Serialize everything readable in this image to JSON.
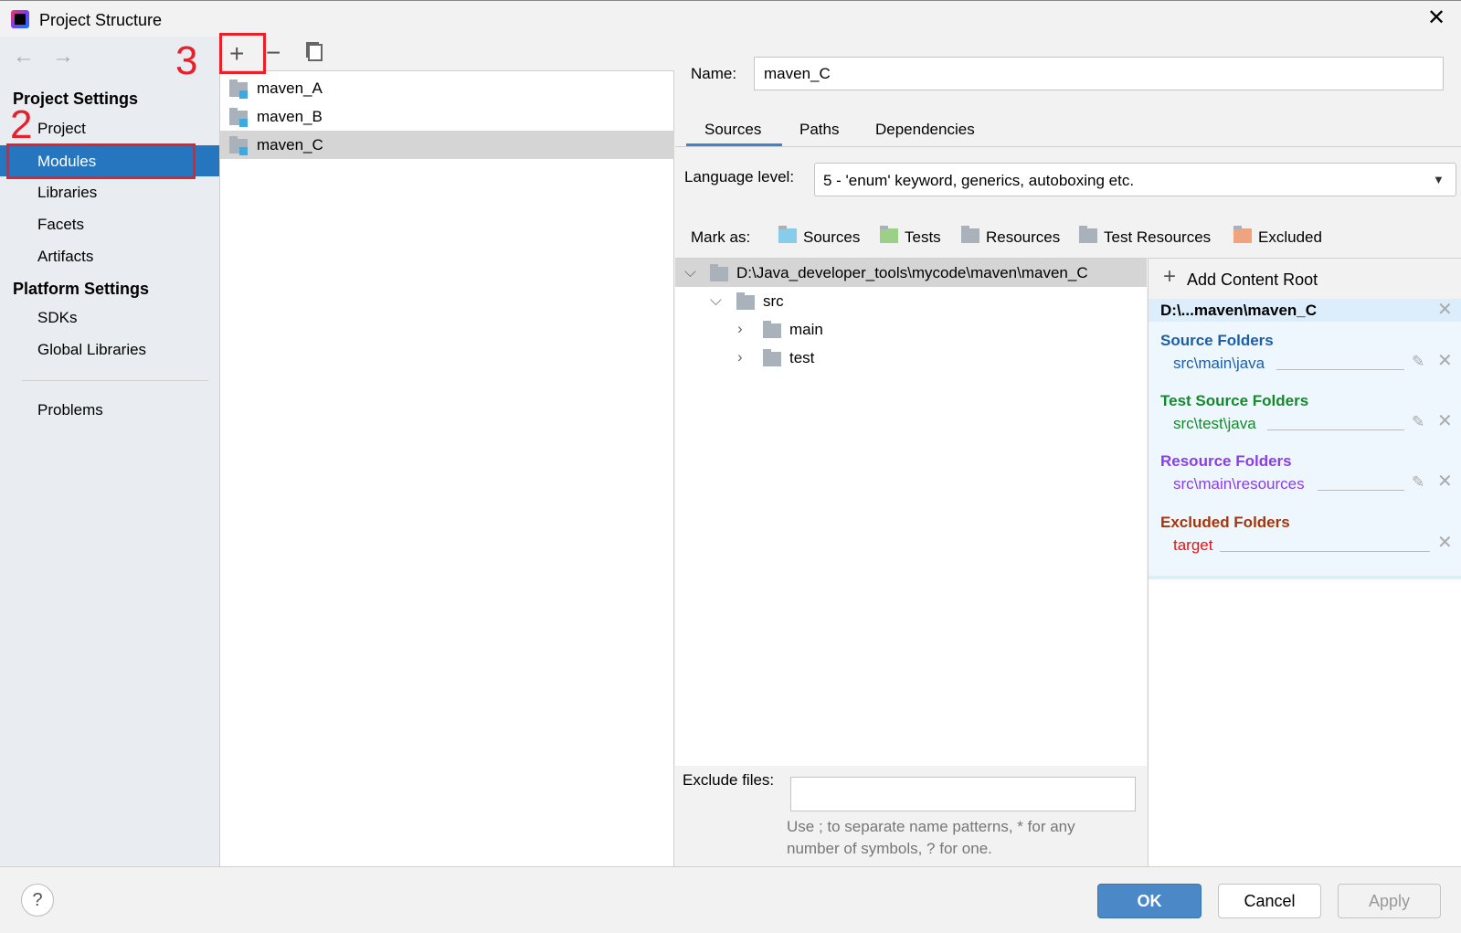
{
  "window": {
    "title": "Project Structure",
    "close_icon": "close-icon"
  },
  "sidebar": {
    "project_settings": "Project Settings",
    "project_items": [
      "Project",
      "Modules",
      "Libraries",
      "Facets",
      "Artifacts"
    ],
    "platform_settings": "Platform Settings",
    "platform_items": [
      "SDKs",
      "Global Libraries"
    ],
    "problems": "Problems",
    "selected": "Modules"
  },
  "modules": {
    "items": [
      "maven_A",
      "maven_B",
      "maven_C"
    ],
    "selected": "maven_C"
  },
  "annotations": {
    "step2": "2",
    "step3": "3",
    "color": "#e8202a"
  },
  "detail": {
    "name_label": "Name:",
    "name_value": "maven_C",
    "tabs": [
      "Sources",
      "Paths",
      "Dependencies"
    ],
    "active_tab": "Sources",
    "language_label": "Language level:",
    "language_value": "5 - 'enum' keyword, generics, autoboxing etc.",
    "mark_as_label": "Mark as:",
    "mark_as": [
      {
        "label": "Sources",
        "color": "#87cce8"
      },
      {
        "label": "Tests",
        "color": "#9ccf87"
      },
      {
        "label": "Resources",
        "color": "#a9b2ba"
      },
      {
        "label": "Test Resources",
        "color": "#a9b2ba"
      },
      {
        "label": "Excluded",
        "color": "#f0a47e"
      }
    ],
    "tree": {
      "root": "D:\\Java_developer_tools\\mycode\\maven\\maven_C",
      "src": "src",
      "main": "main",
      "test": "test"
    },
    "content_root": {
      "add_label": "Add Content Root",
      "root": "D:\\...maven\\maven_C",
      "groups": [
        {
          "title": "Source Folders",
          "path": "src\\main\\java",
          "title_color": "#1d5ea8",
          "path_color": "#1d5ea8",
          "editable": true
        },
        {
          "title": "Test Source Folders",
          "path": "src\\test\\java",
          "title_color": "#138a2c",
          "path_color": "#138a2c",
          "editable": true
        },
        {
          "title": "Resource Folders",
          "path": "src\\main\\resources",
          "title_color": "#8a3ee8",
          "path_color": "#8a3ee8",
          "editable": true
        },
        {
          "title": "Excluded Folders",
          "path": "target",
          "title_color": "#a5350a",
          "path_color": "#ee1010",
          "editable": false
        }
      ]
    },
    "exclude_label": "Exclude files:",
    "exclude_value": "",
    "hint1": "Use ; to separate name patterns, * for any",
    "hint2": "number of symbols, ? for one."
  },
  "footer": {
    "ok": "OK",
    "cancel": "Cancel",
    "apply": "Apply",
    "help": "?"
  }
}
